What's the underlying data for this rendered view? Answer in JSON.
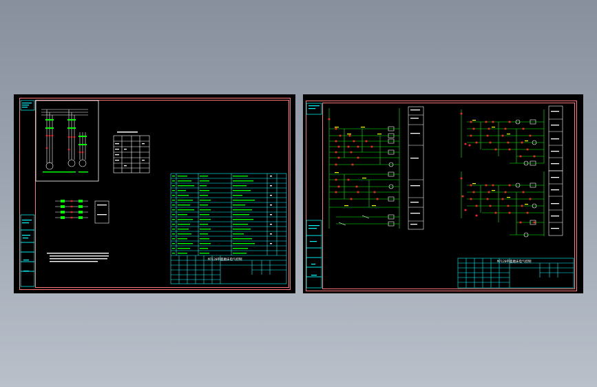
{
  "left_sheet": {
    "title_block_text": "M7120平面磨床电气控制",
    "side_labels": [
      "",
      "",
      "",
      "",
      ""
    ],
    "note_text": "",
    "small_box_label": ""
  },
  "right_sheet": {
    "title_block_text": "M7120平面磨床电气控制",
    "side_labels": [
      "",
      "",
      "",
      "",
      ""
    ]
  },
  "colors": {
    "frame": "#ff7878",
    "table_lines": "#00ffff",
    "wires": "#00ff00",
    "contacts": "#ff2020",
    "component_text": "#ffff00",
    "labels": "#ffffff",
    "background": "#000000"
  }
}
